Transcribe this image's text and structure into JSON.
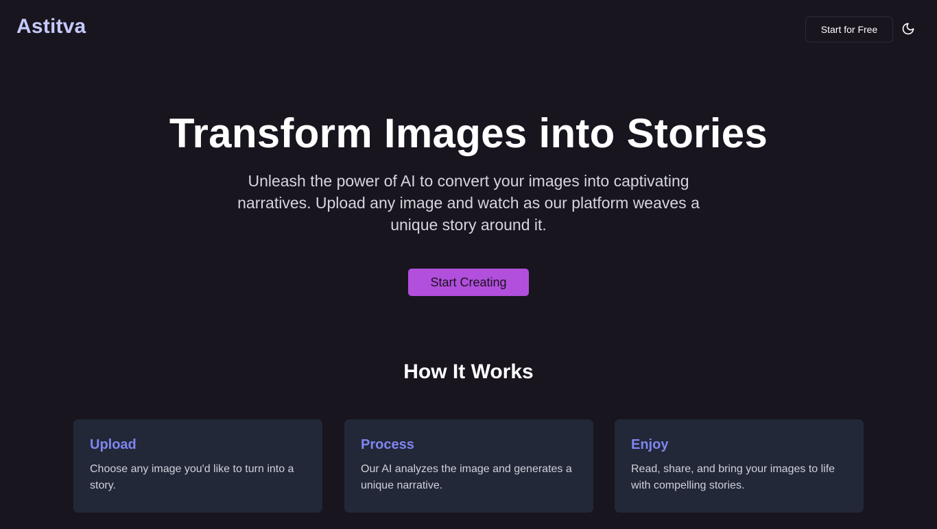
{
  "header": {
    "logo": "Astitva",
    "cta_label": "Start for Free",
    "theme_icon": "moon-icon"
  },
  "hero": {
    "title": "Transform Images into Stories",
    "subtitle": "Unleash the power of AI to convert your images into captivating narratives. Upload any image and watch as our platform weaves a unique story around it.",
    "cta_label": "Start Creating"
  },
  "how_it_works": {
    "title": "How It Works",
    "cards": [
      {
        "title": "Upload",
        "text": "Choose any image you'd like to turn into a story."
      },
      {
        "title": "Process",
        "text": "Our AI analyzes the image and generates a unique narrative."
      },
      {
        "title": "Enjoy",
        "text": "Read, share, and bring your images to life with compelling stories."
      }
    ]
  },
  "colors": {
    "background": "#18151f",
    "logo": "#c5c9fb",
    "accent": "#b24fdc",
    "card_bg": "#222837",
    "card_title": "#7f86ef"
  }
}
